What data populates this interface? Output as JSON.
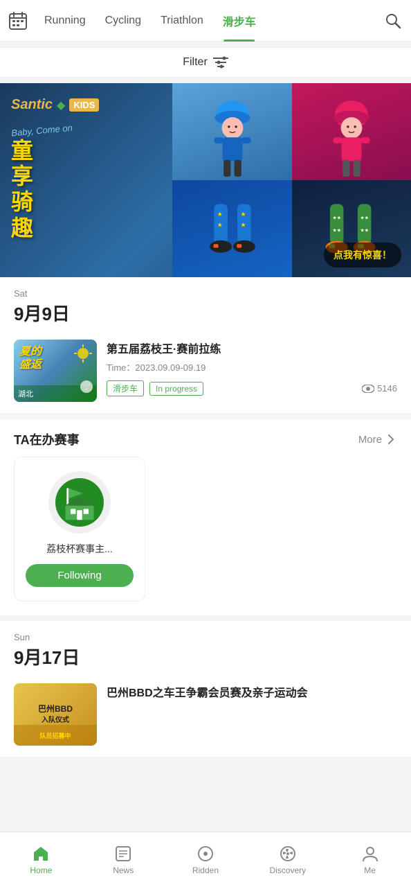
{
  "nav": {
    "tabs": [
      {
        "id": "running",
        "label": "Running",
        "active": false
      },
      {
        "id": "cycling",
        "label": "Cycling",
        "active": false
      },
      {
        "id": "triathlon",
        "label": "Triathlon",
        "active": false
      },
      {
        "id": "skating",
        "label": "滑步车",
        "active": true
      }
    ],
    "search_title": "search"
  },
  "filter": {
    "label": "Filter"
  },
  "banner": {
    "brand": "Santic",
    "brand_sub": "KIDS",
    "slogan": "Baby, Come on",
    "cta": "点我有惊喜！",
    "chars": [
      "童",
      "享",
      "骑",
      "趣"
    ]
  },
  "date1": {
    "day": "Sat",
    "full": "9月9日"
  },
  "event1": {
    "title": "第五届荔枝王·赛前拉练",
    "time_label": "Time：",
    "time_value": "2023.09.09-09.19",
    "tag1": "滑步车",
    "tag2": "In progress",
    "views": "5146",
    "thumb_text1": "夏的",
    "thumb_text2": "盛返",
    "thumb_location": "湖北"
  },
  "ta_section": {
    "title": "TA在办赛事",
    "more": "More"
  },
  "organizer": {
    "name": "荔枝杯赛事主...",
    "following_label": "Following"
  },
  "date2": {
    "day": "Sun",
    "full": "9月17日"
  },
  "event2": {
    "title": "巴州BBD之车王争霸会员赛及亲子运动会",
    "thumb_text": "巴州BBD\n入队仪式"
  },
  "bottom_nav": {
    "items": [
      {
        "id": "home",
        "label": "Home",
        "icon": "🏠",
        "active": true
      },
      {
        "id": "news",
        "label": "News",
        "icon": "📰",
        "active": false
      },
      {
        "id": "ridden",
        "label": "Ridden",
        "icon": "⊙",
        "active": false
      },
      {
        "id": "discovery",
        "label": "Discovery",
        "icon": "◎",
        "active": false
      },
      {
        "id": "me",
        "label": "Me",
        "icon": "👤",
        "active": false
      }
    ]
  },
  "colors": {
    "green": "#4CAF50",
    "active_nav": "#4CAF50",
    "inactive_nav": "#888"
  }
}
